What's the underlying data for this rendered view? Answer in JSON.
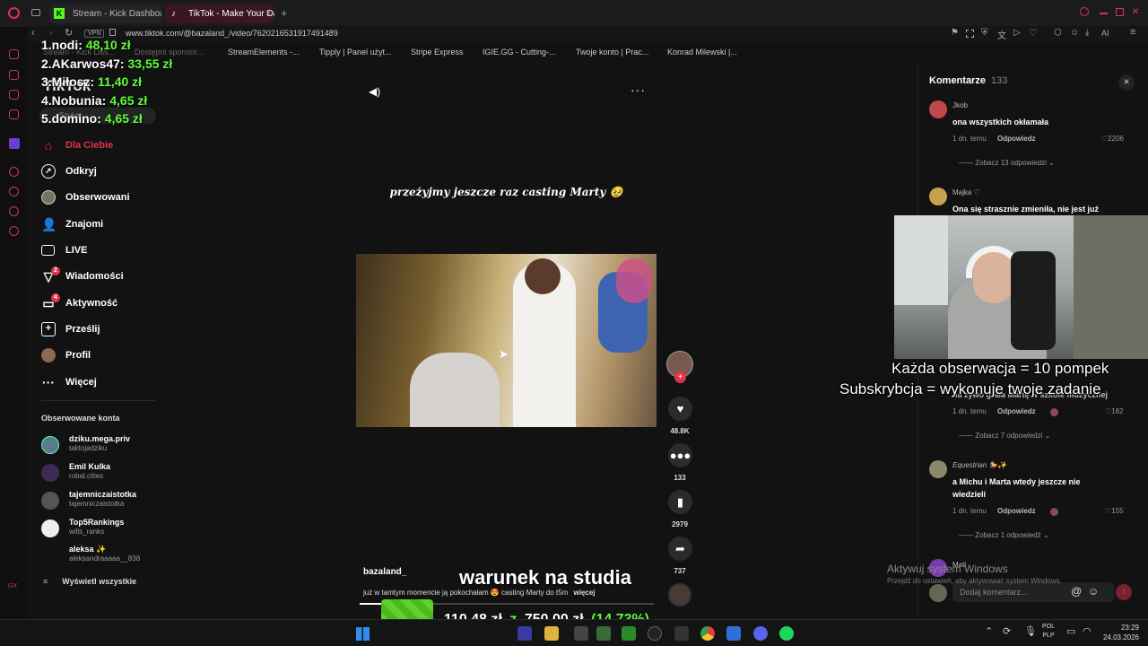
{
  "browser": {
    "tabs": [
      {
        "label": "Stream - Kick Dashboa",
        "active": false
      },
      {
        "label": "TikTok - Make Your Da",
        "active": true
      }
    ],
    "vpn_label": "VPN",
    "url": "www.tiktok.com/@bazaland_/video/7620216531917491489",
    "bookmarks": [
      "Stream - Kick Das...",
      "Dostępni sponsor...",
      "StreamElements -...",
      "Tipply | Panel użyt...",
      "Stripe Express",
      "IGIE.GG - Cutting-...",
      "Twoje konto | Prac...",
      "Konrad Milewski |..."
    ],
    "ai_label": "AI",
    "accent": "#e0324a"
  },
  "leaderboard": [
    {
      "rank": "1.nodi:",
      "amount": "48,10 zł"
    },
    {
      "rank": "2.AKarwos47:",
      "amount": "33,55 zł"
    },
    {
      "rank": "3.Miłosz:",
      "amount": "11,40 zł"
    },
    {
      "rank": "4.Nobunia:",
      "amount": "4,65 zł"
    },
    {
      "rank": "5.domino:",
      "amount": "4,65 zł"
    }
  ],
  "tiktok": {
    "logo": "TikTok",
    "search_placeholder": "Szukaj",
    "nav": [
      {
        "label": "Dla Ciebie",
        "icon": "home-icon",
        "active": true
      },
      {
        "label": "Odkryj",
        "icon": "compass-icon",
        "active": false
      },
      {
        "label": "Obserwowani",
        "icon": "avatar",
        "active": false
      },
      {
        "label": "Znajomi",
        "icon": "friends-icon",
        "active": false
      },
      {
        "label": "LIVE",
        "icon": "live-icon",
        "active": false
      },
      {
        "label": "Wiadomości",
        "icon": "messages-icon",
        "badge": "2",
        "active": false
      },
      {
        "label": "Aktywność",
        "icon": "activity-icon",
        "badge": "4",
        "active": false
      },
      {
        "label": "Prześlij",
        "icon": "upload-icon",
        "active": false
      },
      {
        "label": "Profil",
        "icon": "profile-avatar",
        "active": false
      },
      {
        "label": "Więcej",
        "icon": "more-icon",
        "active": false
      }
    ],
    "followed_title": "Obserwowane konta",
    "followed": [
      {
        "name": "dziku.mega.priv",
        "handle": "taktojadziku"
      },
      {
        "name": "Emil Kulka",
        "handle": "robal.cities"
      },
      {
        "name": "tajemniczaistotka",
        "handle": "tajemniczaistotka"
      },
      {
        "name": "Top5Rankings",
        "handle": "wills_ranks"
      },
      {
        "name": "aleksa ✨",
        "handle": "aleksandraaaaa__838"
      }
    ],
    "show_all": "Wyświetl wszystkie"
  },
  "video": {
    "caption_top": "przeżyjmy jeszcze raz casting Marty 🥹",
    "author": "bazaland_",
    "description": "już w tamtym momencie ją pokochałam 😍 casting Marty do t5m",
    "more": "więcej",
    "actions": [
      {
        "icon": "heart-icon",
        "count": "48.8K"
      },
      {
        "icon": "comment-icon",
        "count": "133"
      },
      {
        "icon": "bookmark-icon",
        "count": "2979"
      },
      {
        "icon": "share-icon",
        "count": "737"
      }
    ]
  },
  "comments": {
    "title": "Komentarze",
    "count": "133",
    "items": [
      {
        "user": "Jkob",
        "text": "ona wszystkich okłamała",
        "time": "1 dn. temu",
        "reply": "Odpowiedz",
        "likes": "2206",
        "replies": "Zobacz 13 odpowiedzi"
      },
      {
        "user": "Majka ♡",
        "text": "Ona się strasznie zmieniła, nie jest już"
      },
      {
        "text": "na żywo grała Martę w szkole muzycznej",
        "time": "1 dn. temu",
        "reply": "Odpowiedz",
        "likes": "182",
        "replies": "Zobacz 7 odpowiedzi"
      },
      {
        "user": "Equestrian 🐎✨",
        "text": "a Michu i Marta wtedy jeszcze nie wiedzieli",
        "time": "1 dn. temu",
        "reply": "Odpowiedz",
        "likes": "155",
        "replies": "Zobacz 1 odpowiedź"
      },
      {
        "user": "Mati"
      }
    ],
    "input_placeholder": "Dodaj komentarz..."
  },
  "stream_overlay": {
    "line1": "Każda obserwacja = 10 pompek",
    "line2": "Subskrybcja = wykonuje twoje zadanie",
    "bottom_label": "warunek na studia",
    "goal": {
      "current": "110,48 zł",
      "sep": "z",
      "target": "750,00 zł",
      "percent": "(14.73%)",
      "fraction": 0.1473
    }
  },
  "windows": {
    "activate_title": "Aktywuj system Windows",
    "activate_sub": "Przejdź do ustawień, aby aktywować system Windows.",
    "lang1": "POL",
    "lang2": "PLP",
    "time": "23:29",
    "date": "24.03.2026"
  }
}
